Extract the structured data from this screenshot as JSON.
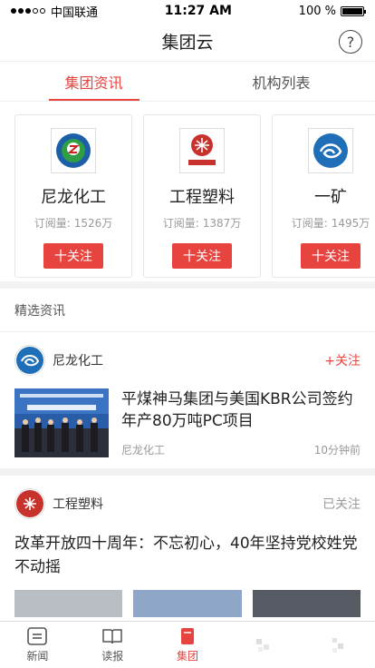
{
  "status": {
    "carrier": "中国联通",
    "time": "11:27 AM",
    "battery": "100 %",
    "battery_level": 1.0
  },
  "nav": {
    "title": "集团云"
  },
  "tabs": [
    {
      "label": "集团资讯"
    },
    {
      "label": "机构列表"
    }
  ],
  "cards": [
    {
      "name": "尼龙化工",
      "sub_label": "订阅量:",
      "sub_value": "1526万",
      "button": "十关注"
    },
    {
      "name": "工程塑料",
      "sub_label": "订阅量:",
      "sub_value": "1387万",
      "button": "十关注"
    },
    {
      "name": "一矿",
      "sub_label": "订阅量:",
      "sub_value": "1495万",
      "button": "十关注"
    }
  ],
  "section": {
    "title": "精选资讯"
  },
  "feed1": {
    "source": "尼龙化工",
    "follow": "+关注",
    "title": "平煤神马集团与美国KBR公司签约年产80万吨PC项目",
    "meta_source": "尼龙化工",
    "meta_time": "10分钟前"
  },
  "feed2": {
    "source": "工程塑料",
    "follow": "已关注",
    "title": "改革开放四十周年：不忘初心，40年坚持党校姓党不动摇"
  },
  "tabbar": [
    {
      "label": "新闻",
      "icon": "news-icon"
    },
    {
      "label": "读报",
      "icon": "book-icon"
    },
    {
      "label": "集团",
      "icon": "group-icon"
    },
    {
      "label": "",
      "icon": "blurred-icon"
    },
    {
      "label": "",
      "icon": "blurred-icon"
    }
  ],
  "colors": {
    "accent": "#e8443f",
    "text": "#222222",
    "muted": "#999999"
  }
}
